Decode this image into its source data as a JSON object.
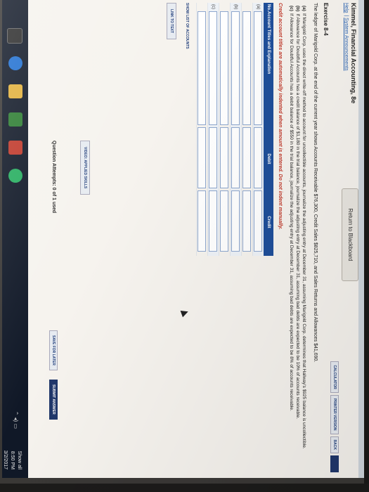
{
  "header": {
    "course_title": "Kimmel, Financial Accounting, 8e",
    "links": [
      "Help",
      "System Announcements"
    ],
    "return_button": "Return to Blackboard"
  },
  "toolbar": {
    "calculator": "CALCULATOR",
    "printer_version": "PRINTER VERSION",
    "back": "BACK",
    "next": ""
  },
  "exercise": {
    "title": "Exercise 8-4",
    "intro": "The ledger of Marigold Corp. at the end of the current year shows Accounts Receivable $76,300, Credit Sales $825,710, and Sales Returns and Allowances $41,690.",
    "parts": [
      {
        "label": "(a)",
        "text": "If Marigold Corp. uses the direct write-off method to account for uncollectible accounts, journalize the adjusting entry at December 31, assuming Marigold Corp. determines that Hallway's $925 balance is uncollectible."
      },
      {
        "label": "(b)",
        "text": "If Allowance for Doubtful Accounts has a credit balance of $1,180 in the trial balance, journalize the adjusting entry at December 31, assuming bad debts are expected to be 10% of accounts receivable."
      },
      {
        "label": "(c)",
        "text": "If Allowance for Doubtful Accounts has a debit balance of $550 in the trial balance, journalize the adjusting entry at December 31, assuming bad debts are expected to be 8% of accounts receivable."
      }
    ],
    "note": "Credit account titles are automatically indented when amount is entered. Do not indent manually."
  },
  "journal_table": {
    "headers": {
      "no": "No.",
      "account": "Account Titles and Explanation",
      "debit": "Debit",
      "credit": "Credit"
    },
    "row_labels": [
      "(a)",
      "",
      "(b)",
      "",
      "(c)",
      ""
    ]
  },
  "footer": {
    "show_list": "SHOW LIST OF ACCOUNTS",
    "link_to_text": "LINK TO TEXT",
    "video": "VIDEO: APPLIED SKILLS",
    "attempts": "Question Attempts: 0 of 1 used",
    "save_later": "SAVE FOR LATER",
    "submit": "SUBMIT ANSWER"
  },
  "taskbar": {
    "show_all": "Show all",
    "time": "8:50 PM",
    "date": "3/2/2017"
  },
  "colors": {
    "header_blue": "#1f4f9a",
    "note_red": "#c0392b",
    "link_blue": "#2b64b3"
  }
}
